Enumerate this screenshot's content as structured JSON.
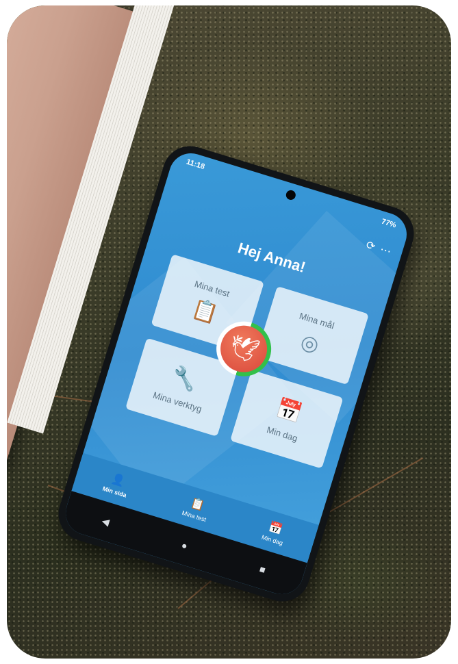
{
  "status_bar": {
    "time": "11:18",
    "battery": "77%"
  },
  "top_actions": {
    "sync_icon": "sync-icon",
    "more_icon": "more-icon"
  },
  "greeting": "Hej Anna!",
  "tiles": [
    {
      "label": "Mina test",
      "icon": "clipboard-icon"
    },
    {
      "label": "Mina mål",
      "icon": "target-icon"
    },
    {
      "label": "Mina verktyg",
      "icon": "wrench-icon"
    },
    {
      "label": "Min dag",
      "icon": "calendar-icon"
    }
  ],
  "center_logo": {
    "icon": "hummingbird-icon",
    "ring_progress": 0.5,
    "ring_color": "#33c04a",
    "badge_color": "#d9473a"
  },
  "bottom_nav": [
    {
      "label": "Min sida",
      "icon": "person-icon",
      "active": true
    },
    {
      "label": "Mina test",
      "icon": "clipboard-icon",
      "active": false
    },
    {
      "label": "Min dag",
      "icon": "calendar-icon",
      "active": false
    }
  ],
  "system_nav": {
    "back_icon": "back-icon",
    "home_icon": "home-icon",
    "recents_icon": "recents-icon"
  },
  "colors": {
    "screen_blue": "#2f8bd0",
    "nav_blue": "#2b86c8"
  }
}
